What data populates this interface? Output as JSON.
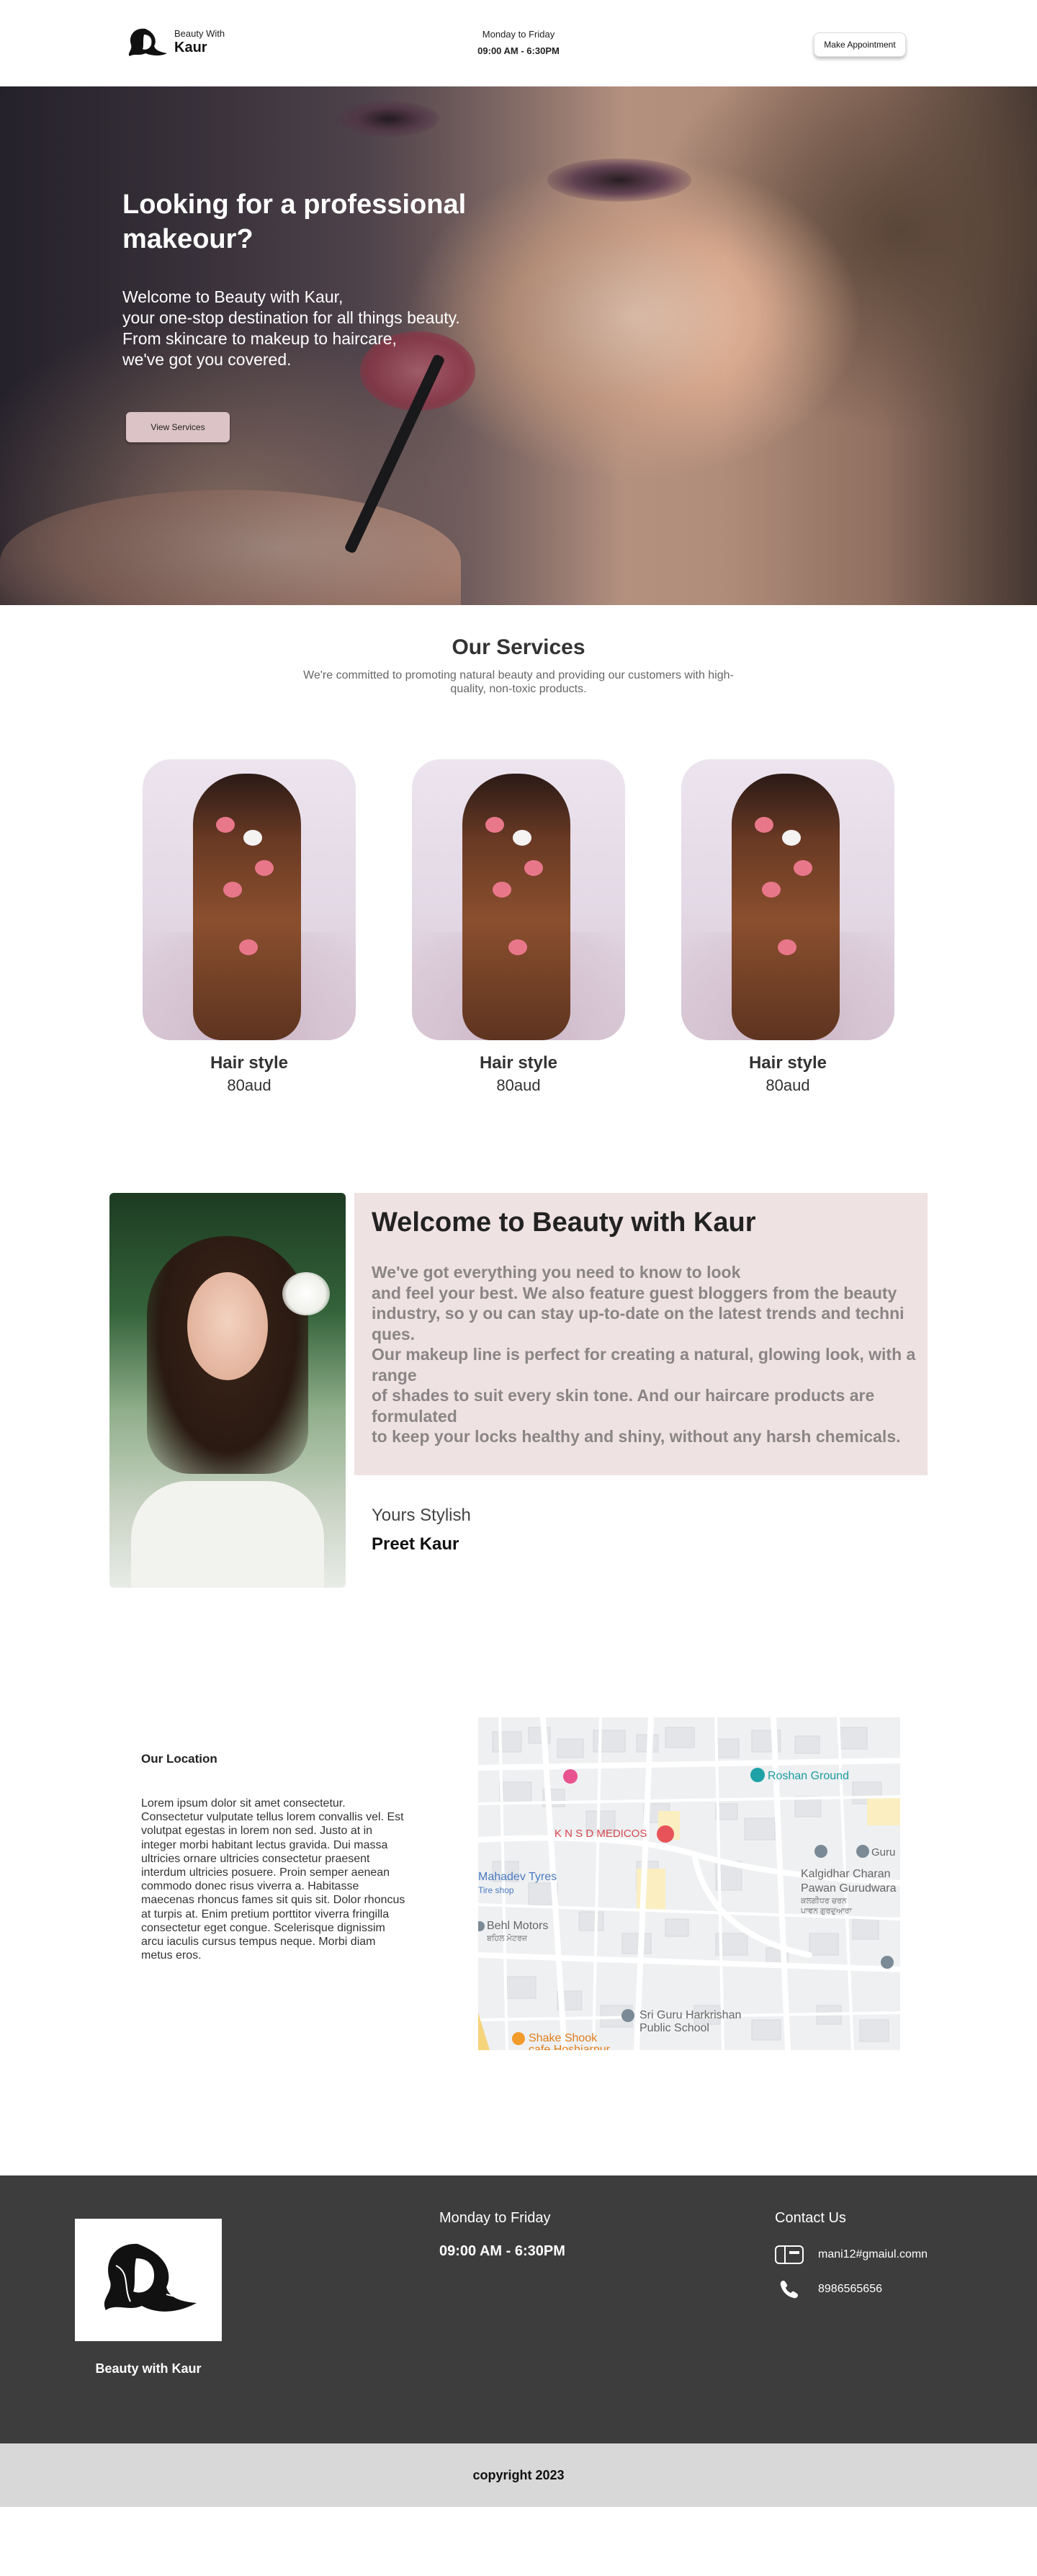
{
  "header": {
    "logo_small": "Beauty With",
    "logo_big": "Kaur",
    "hours_days": "Monday to Friday",
    "hours_time": "09:00 AM - 6:30PM",
    "appointment_button": "Make Appointment"
  },
  "hero": {
    "title": "Looking for a professional makeour?",
    "subtitle_lines": [
      "Welcome to Beauty with Kaur,",
      "your one-stop destination for all things beauty.",
      "From skincare to makeup to haircare,",
      "we've got you covered."
    ],
    "button": "View Services"
  },
  "services": {
    "title": "Our Services",
    "description": "We're committed to promoting natural beauty and providing our customers with high-quality, non-toxic products.",
    "cards": [
      {
        "title": "Hair style",
        "price": "80aud"
      },
      {
        "title": "Hair style",
        "price": "80aud"
      },
      {
        "title": "Hair style",
        "price": "80aud"
      }
    ]
  },
  "welcome": {
    "title": "Welcome to Beauty with Kaur",
    "lines": [
      "We've got everything you need to know to look",
      "and feel your best. We also feature guest bloggers from the beauty",
      "industry, so y ou can stay up-to-date on the latest trends and techni",
      "ques.",
      " Our makeup line is perfect for creating a natural, glowing look, with a",
      "range",
      "of shades to suit every skin tone. And our haircare products are",
      "formulated",
      "to keep your locks healthy and shiny, without any harsh chemicals."
    ],
    "stylist_label": "Yours Stylish",
    "stylist_name": "Preet Kaur"
  },
  "location": {
    "title": "Our Location",
    "text": "Lorem ipsum dolor sit amet consectetur. Consectetur vulputate tellus lorem convallis vel. Est volutpat egestas in lorem non sed. Justo at in integer morbi habitant lectus gravida. Dui massa ultricies ornare ultricies consectetur praesent interdum ultricies posuere. Proin semper aenean commodo donec risus viverra a. Habitasse maecenas rhoncus fames sit quis sit. Dolor rhoncus at turpis at. Enim pretium porttitor viverra fringilla consectetur eget congue. Scelerisque dignissim arcu iaculis cursus tempus neque. Morbi diam metus eros.",
    "map_labels": {
      "roshan": "Roshan Ground",
      "medicos": "K N S D MEDICOS",
      "mahadev": "Mahadev Tyres",
      "mahadev_sub": "Tire shop",
      "behl": "Behl Motors",
      "behl_sub": "ਬਹਿਲ ਮੋਟਰਜ਼",
      "kalgidhar1": "Kalgidhar Charan",
      "kalgidhar2": "Pawan Gurudwara",
      "kalgidhar3": "ਕਲਗੀਧਰ ਚਰਨ",
      "kalgidhar4": "ਪਾਵਨ ਗੁਰਦੁਆਰਾ",
      "guru": "Guru",
      "school1": "Sri Guru Harkrishan",
      "school2": "Public School",
      "shake1": "Shake Shook",
      "shake2": "cafe Hoshiarpur"
    }
  },
  "footer": {
    "brand": "Beauty with Kaur",
    "days": "Monday to Friday",
    "hours": "09:00 AM - 6:30PM",
    "contact_title": "Contact Us",
    "email": "mani12#gmaiul.comn",
    "phone": "8986565656"
  },
  "copyright": "copyright 2023"
}
